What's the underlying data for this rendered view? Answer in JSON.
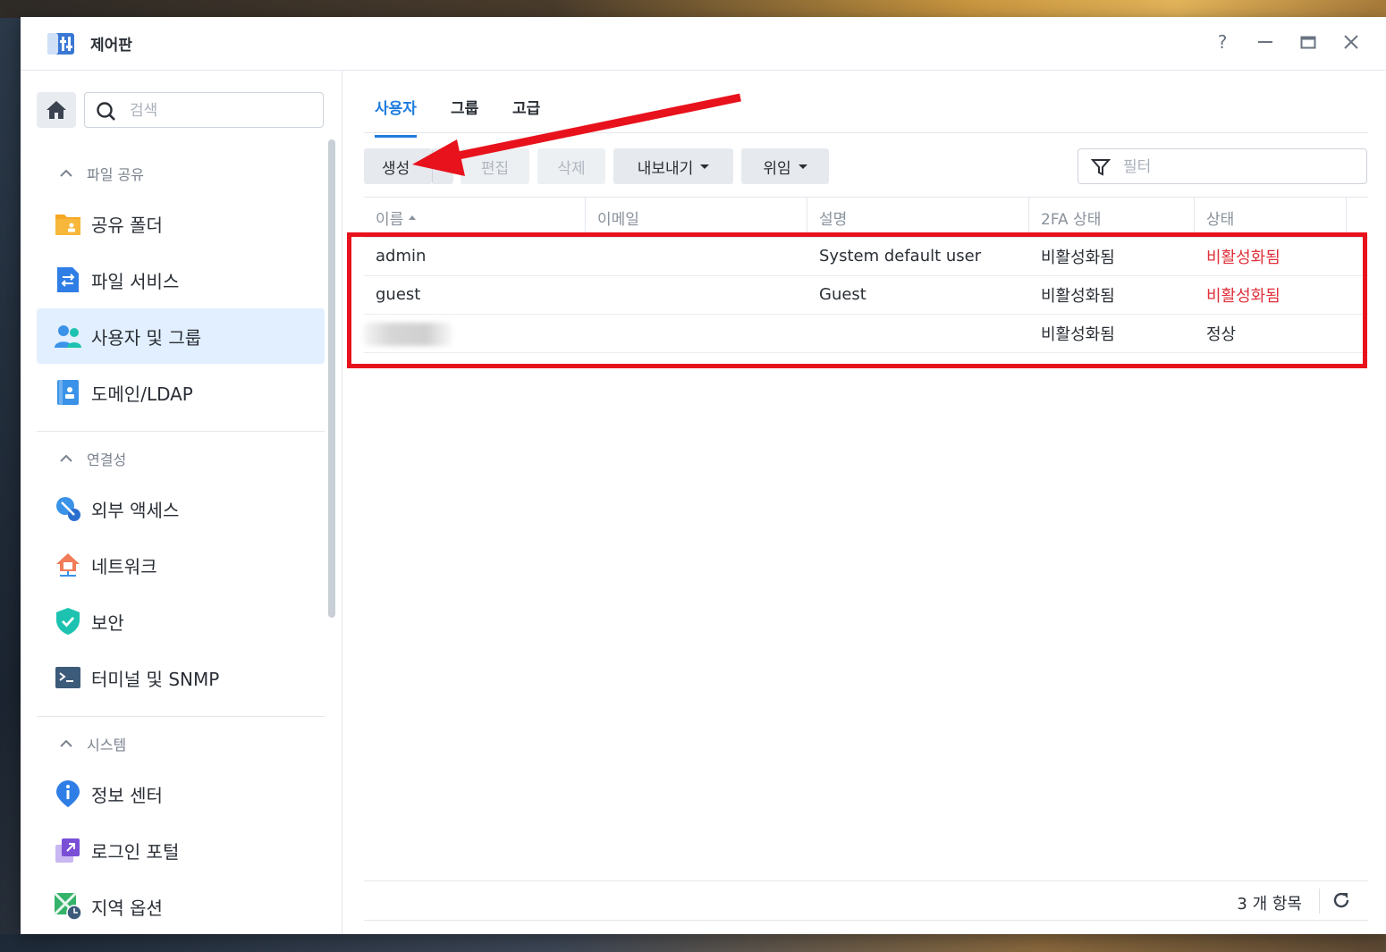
{
  "window": {
    "title": "제어판",
    "controls": {
      "help": "?",
      "minimize": "—",
      "maximize": "▭",
      "close": "✕"
    }
  },
  "sidebar": {
    "search_placeholder": "검색",
    "sections": [
      {
        "label": "파일 공유",
        "items": [
          {
            "label": "공유 폴더"
          },
          {
            "label": "파일 서비스"
          },
          {
            "label": "사용자 및 그룹"
          },
          {
            "label": "도메인/LDAP"
          }
        ]
      },
      {
        "label": "연결성",
        "items": [
          {
            "label": "외부 액세스"
          },
          {
            "label": "네트워크"
          },
          {
            "label": "보안"
          },
          {
            "label": "터미널 및 SNMP"
          }
        ]
      },
      {
        "label": "시스템",
        "items": [
          {
            "label": "정보 센터"
          },
          {
            "label": "로그인 포털"
          },
          {
            "label": "지역 옵션"
          }
        ]
      }
    ],
    "active_item": "사용자 및 그룹"
  },
  "tabs": [
    {
      "label": "사용자"
    },
    {
      "label": "그룹"
    },
    {
      "label": "고급"
    }
  ],
  "toolbar": {
    "create": "생성",
    "edit": "편집",
    "delete": "삭제",
    "export": "내보내기",
    "delegate": "위임",
    "filter_placeholder": "필터"
  },
  "table": {
    "columns": [
      "이름",
      "이메일",
      "설명",
      "2FA 상태",
      "상태"
    ],
    "rows": [
      {
        "name": "admin",
        "email": "",
        "description": "System default user",
        "twofa": "비활성화됨",
        "status": "비활성화됨"
      },
      {
        "name": "guest",
        "email": "",
        "description": "Guest",
        "twofa": "비활성화됨",
        "status": "비활성화됨"
      },
      {
        "name": "",
        "email": "",
        "description": "",
        "twofa": "비활성화됨",
        "status": "정상"
      }
    ]
  },
  "footer": {
    "count_text": "3 개 항목"
  },
  "colors": {
    "accent": "#1d7ce0",
    "annotation_red": "#e8121c",
    "disabled_status": "#e0313b"
  }
}
